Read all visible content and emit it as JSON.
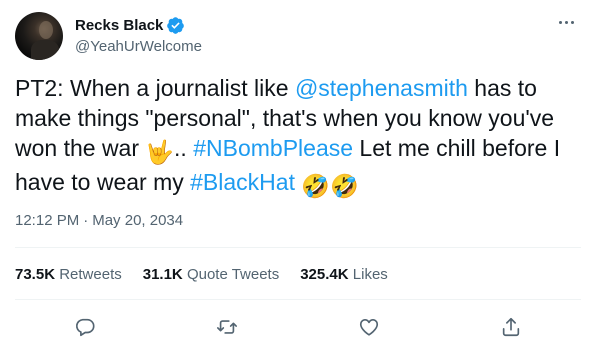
{
  "author": {
    "display_name": "Recks Black",
    "handle": "@YeahUrWelcome",
    "verified": true
  },
  "tweet": {
    "segments": [
      {
        "type": "text",
        "value": "PT2: When a journalist like "
      },
      {
        "type": "link",
        "value": "@stephenasmith"
      },
      {
        "type": "text",
        "value": " has to make things \"personal\", that's when you know you've won the war "
      },
      {
        "type": "emoji",
        "value": "🤟",
        "icon": "love-you-gesture-icon"
      },
      {
        "type": "text",
        "value": ".. "
      },
      {
        "type": "link",
        "value": "#NBombPlease"
      },
      {
        "type": "text",
        "value": " Let me chill before I have to wear my "
      },
      {
        "type": "link",
        "value": "#BlackHat"
      },
      {
        "type": "text",
        "value": " "
      },
      {
        "type": "emoji",
        "value": "🤣",
        "icon": "rofl-emoji-icon"
      },
      {
        "type": "emoji",
        "value": "🤣",
        "icon": "rofl-emoji-icon"
      }
    ]
  },
  "timestamp": {
    "time": "12:12 PM",
    "separator": "·",
    "date": "May 20, 2034"
  },
  "stats": [
    {
      "count": "73.5K",
      "label": "Retweets"
    },
    {
      "count": "31.1K",
      "label": "Quote Tweets"
    },
    {
      "count": "325.4K",
      "label": "Likes"
    }
  ],
  "actions": [
    "reply-icon",
    "retweet-icon",
    "like-icon",
    "share-icon"
  ],
  "colors": {
    "link": "#1d9bf0",
    "secondary_text": "#536471",
    "primary_text": "#0f1419",
    "divider": "#eff3f4",
    "verified_badge": "#1d9bf0"
  }
}
